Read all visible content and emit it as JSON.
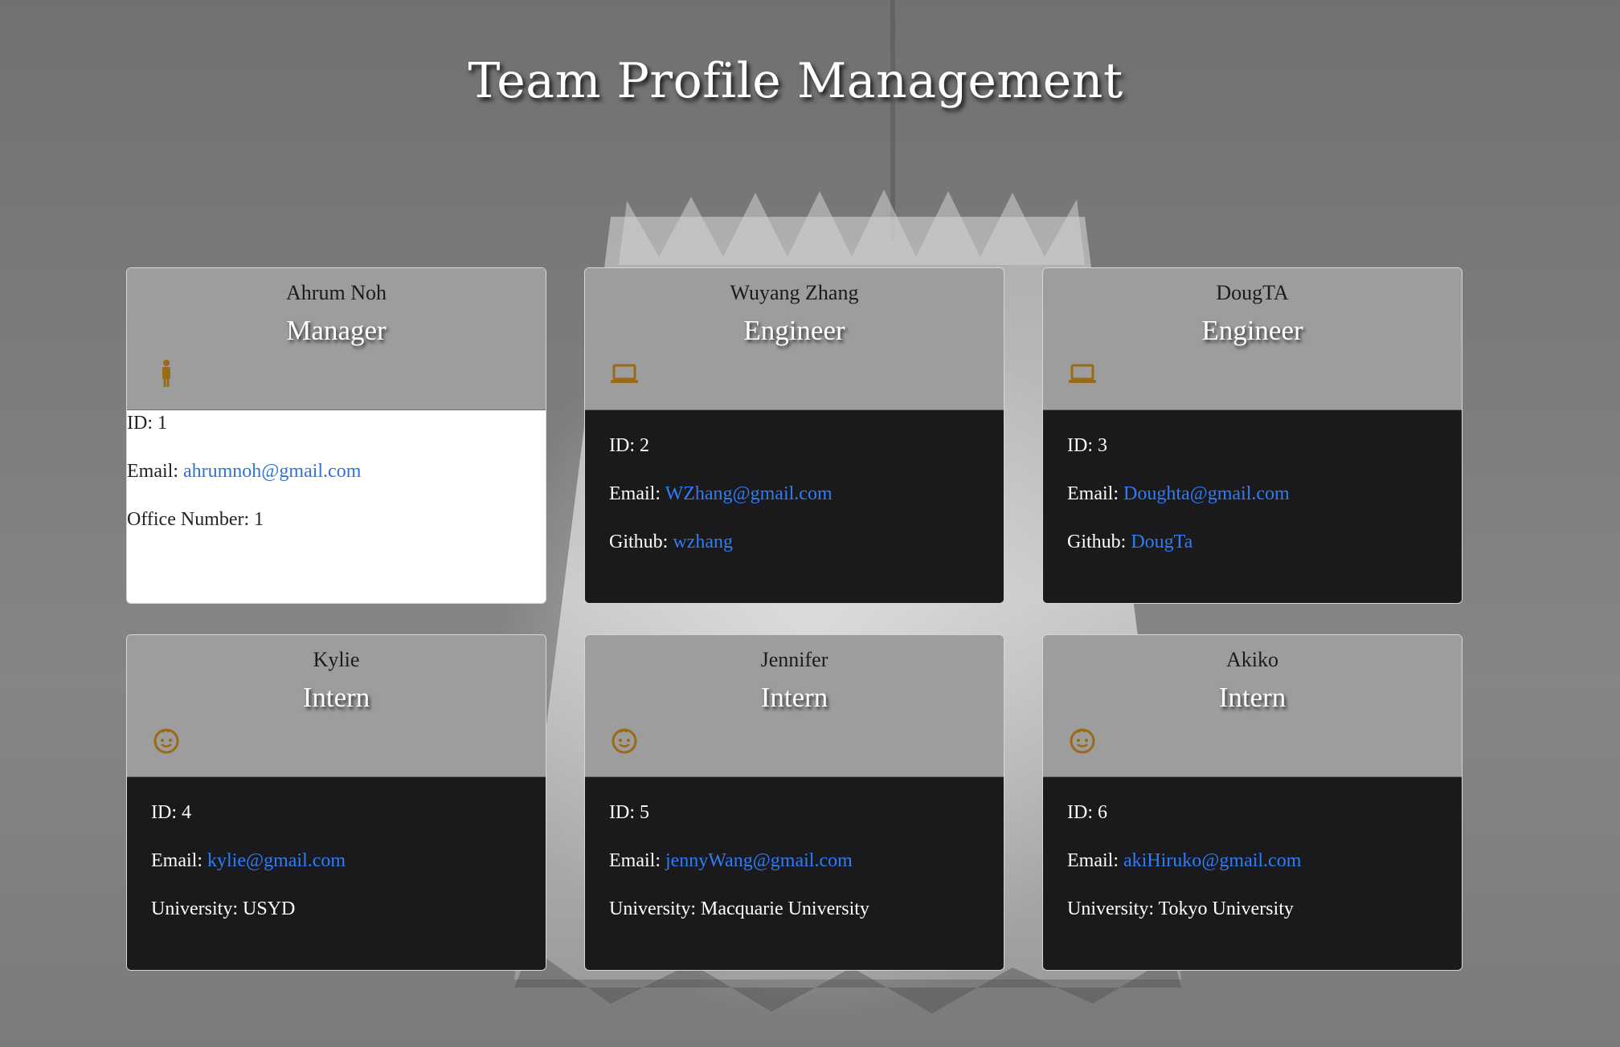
{
  "page": {
    "title": "Team Profile Management"
  },
  "colors": {
    "header_bg": "#9d9d9d",
    "body_dark": "#1a191b",
    "body_light": "#ffffff",
    "link": "#2f7cf6",
    "icon": "#9b6a16"
  },
  "cards": [
    {
      "name": "Ahrum Noh",
      "role": "Manager",
      "icon": "person-icon",
      "theme": "light",
      "id_label": "ID: 1",
      "email_label": "Email: ",
      "email": "ahrumnoh@gmail.com",
      "extra_label": "Office Number: 1",
      "extra_value": ""
    },
    {
      "name": "Wuyang Zhang",
      "role": "Engineer",
      "icon": "laptop-icon",
      "theme": "dark",
      "id_label": "ID: 2",
      "email_label": "Email: ",
      "email": "WZhang@gmail.com",
      "extra_label": "Github: ",
      "extra_value": "wzhang"
    },
    {
      "name": "DougTA",
      "role": "Engineer",
      "icon": "laptop-icon",
      "theme": "dark",
      "id_label": "ID: 3",
      "email_label": "Email: ",
      "email": "Doughta@gmail.com",
      "extra_label": "Github: ",
      "extra_value": "DougTa"
    },
    {
      "name": "Kylie",
      "role": "Intern",
      "icon": "baby-face-icon",
      "theme": "dark",
      "id_label": "ID: 4",
      "email_label": "Email: ",
      "email": "kylie@gmail.com",
      "extra_label": "University: USYD",
      "extra_value": ""
    },
    {
      "name": "Jennifer",
      "role": "Intern",
      "icon": "baby-face-icon",
      "theme": "dark",
      "id_label": "ID: 5",
      "email_label": "Email: ",
      "email": "jennyWang@gmail.com",
      "extra_label": "University: Macquarie University",
      "extra_value": ""
    },
    {
      "name": "Akiko",
      "role": "Intern",
      "icon": "baby-face-icon",
      "theme": "dark",
      "id_label": "ID: 6",
      "email_label": "Email: ",
      "email": "akiHiruko@gmail.com",
      "extra_label": "University: Tokyo University",
      "extra_value": ""
    }
  ]
}
